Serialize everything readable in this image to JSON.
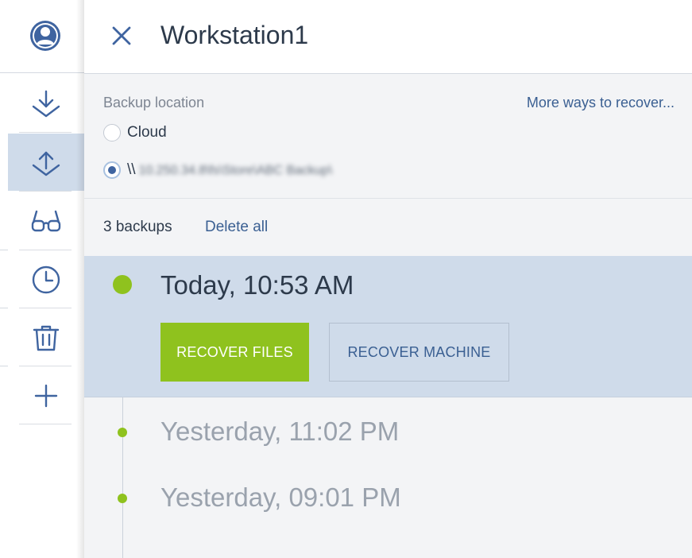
{
  "nav": {
    "items": [
      {
        "name": "user",
        "icon": "user-icon"
      },
      {
        "name": "backup",
        "icon": "download-icon"
      },
      {
        "name": "recovery",
        "icon": "upload-icon"
      },
      {
        "name": "view",
        "icon": "glasses-icon"
      },
      {
        "name": "history",
        "icon": "clock-icon"
      },
      {
        "name": "delete",
        "icon": "trash-icon"
      },
      {
        "name": "add",
        "icon": "plus-icon"
      }
    ],
    "active": "recovery"
  },
  "panel": {
    "title": "Workstation1",
    "backup_location_label": "Backup location",
    "more_ways_link": "More ways to recover...",
    "locations": [
      {
        "label": "Cloud",
        "checked": false
      },
      {
        "label_prefix": "\\\\",
        "label_blurred": "10.250.34.8\\fs\\Store\\ABC Backup\\",
        "checked": true
      }
    ],
    "backups_count": "3 backups",
    "delete_all": "Delete all",
    "backups": [
      {
        "time": "Today, 10:53 AM",
        "active": true
      },
      {
        "time": "Yesterday, 11:02 PM",
        "active": false
      },
      {
        "time": "Yesterday, 09:01 PM",
        "active": false
      }
    ],
    "buttons": {
      "recover_files": "RECOVER FILES",
      "recover_machine": "RECOVER MACHINE"
    }
  },
  "colors": {
    "accent_green": "#8fc21e",
    "link_blue": "#3a5f92",
    "active_row": "#cfdbea",
    "icon_blue": "#3f64a0"
  }
}
